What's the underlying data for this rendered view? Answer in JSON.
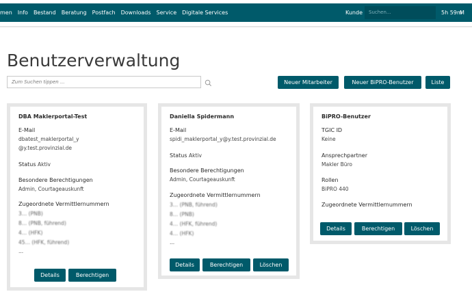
{
  "nav": {
    "items": [
      "men",
      "Info",
      "Bestand",
      "Beratung",
      "Postfach",
      "Downloads",
      "Service",
      "Digitale Services"
    ],
    "kunde": "Kunde",
    "search_placeholder": "Suchen...",
    "timer": "5h 59m",
    "more": "M"
  },
  "page": {
    "title": "Benutzerverwaltung",
    "search_placeholder": "Zum Suchen tippen ..."
  },
  "actions": {
    "new_employee": "Neuer Mitarbeiter",
    "new_bipro": "Neuer BiPRO-Benutzer",
    "list": "Liste"
  },
  "cards": [
    {
      "name": "DBA Maklerportal-Test",
      "email_label": "E-Mail",
      "email_line1": "dbatest_maklerportal_y",
      "email_line2": "@y.test.provinzial.de",
      "status_label": "Status",
      "status_value": "Aktiv",
      "rights_label": "Besondere Berechtigungen",
      "rights_value": "Admin, Courtageauskunft",
      "numbers_label": "Zugeordnete Vermittlernummern",
      "numbers": [
        "3… (PNB)",
        "8… (PNB, führend)",
        "4… (HFK)",
        "45… (HFK, führend)"
      ],
      "more": "...",
      "details": "Details",
      "rights_btn": "Berechtigen"
    },
    {
      "name": "Daniella Spidermann",
      "email_label": "E-Mail",
      "email_line1": "spidi_maklerportal_y@y.test.provinzial.de",
      "status_label": "Status",
      "status_value": "Aktiv",
      "rights_label": "Besondere Berechtigungen",
      "rights_value": "Admin, Courtageauskunft",
      "numbers_label": "Zugeordnete Vermittlernummern",
      "numbers": [
        "3… (PNB, führend)",
        "8… (PNB)",
        "4… (HFK, führend)",
        "4… (HFK)"
      ],
      "more": "...",
      "details": "Details",
      "rights_btn": "Berechtigen",
      "delete": "Löschen"
    },
    {
      "name": "BiPRO-Benutzer",
      "tgic_label": "TGIC ID",
      "tgic_value": "Keine",
      "partner_label": "Ansprechpartner",
      "partner_value": "Makler Büro",
      "roles_label": "Rollen",
      "roles_value": "BiPRO 440",
      "numbers_label": "Zugeordnete Vermittlernummern",
      "details": "Details",
      "rights_btn": "Berechtigen",
      "delete": "Löschen"
    }
  ],
  "colors": {
    "brand": "#005a6a",
    "card_border": "#e6e6e6"
  }
}
